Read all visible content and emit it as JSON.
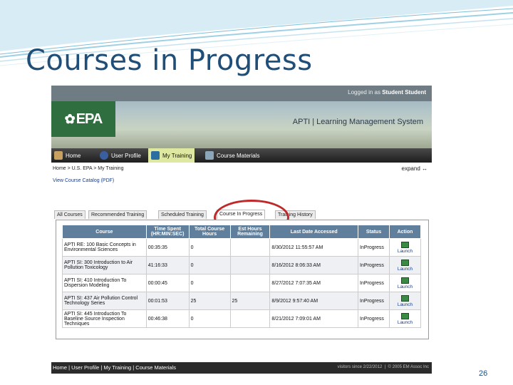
{
  "slide": {
    "title": "Courses in Progress",
    "page_number": "26"
  },
  "header": {
    "logged_in_prefix": "Logged in as",
    "user_name": "Student Student",
    "lms_title": "APTI | Learning Management System",
    "logo_text": "EPA"
  },
  "nav": [
    {
      "label": "Home",
      "icon": "house-icon"
    },
    {
      "label": "User Profile",
      "icon": "user-icon"
    },
    {
      "label": "My Training",
      "icon": "training-icon"
    },
    {
      "label": "Course Materials",
      "icon": "download-icon"
    }
  ],
  "breadcrumb": "Home > U.S. EPA > My Training",
  "expand_label": "expand ↔",
  "catalog_link": "View Course Catalog (PDF)",
  "tabs": [
    {
      "label": "All Courses"
    },
    {
      "label": "Recommended Training"
    },
    {
      "label": "Scheduled Training"
    },
    {
      "label": "Course In Progress"
    },
    {
      "label": "Training History"
    }
  ],
  "table": {
    "headers": [
      "Course",
      "Time Spent (HR:MIN:SEC)",
      "Total Course Hours",
      "Est Hours Remaining",
      "Last Date Accessed",
      "Status",
      "Action"
    ],
    "rows": [
      {
        "course": "APTI RE: 100 Basic Concepts in Environmental Sciences",
        "time": "00:35:35",
        "hours": "0",
        "remaining": "",
        "date": "8/30/2012 11:55:57 AM",
        "status": "InProgress",
        "action": "Launch"
      },
      {
        "course": "APTI SI: 300 Introduction to Air Pollution Toxicology",
        "time": "41:16:33",
        "hours": "0",
        "remaining": "",
        "date": "8/16/2012 8:06:33 AM",
        "status": "InProgress",
        "action": "Launch"
      },
      {
        "course": "APTI SI: 410 Introduction To Dispersion Modeling",
        "time": "00:00:45",
        "hours": "0",
        "remaining": "",
        "date": "8/27/2012 7:07:35 AM",
        "status": "InProgress",
        "action": "Launch"
      },
      {
        "course": "APTI SI: 437 Air Pollution Control Technology Series",
        "time": "00:01:53",
        "hours": "25",
        "remaining": "25",
        "date": "8/9/2012 9:57:40 AM",
        "status": "InProgress",
        "action": "Launch"
      },
      {
        "course": "APTI SI: 445 Introduction To Baseline Source Inspection Techniques",
        "time": "00:46:38",
        "hours": "0",
        "remaining": "",
        "date": "8/21/2012 7:09:01 AM",
        "status": "InProgress",
        "action": "Launch"
      }
    ]
  },
  "footer": {
    "links": "Home | User Profile | My Training | Course Materials",
    "visitors_prefix": "visitors since",
    "visitors_date": "2/22/2012",
    "copyright": "© 2005 EM Assoc Inc"
  }
}
